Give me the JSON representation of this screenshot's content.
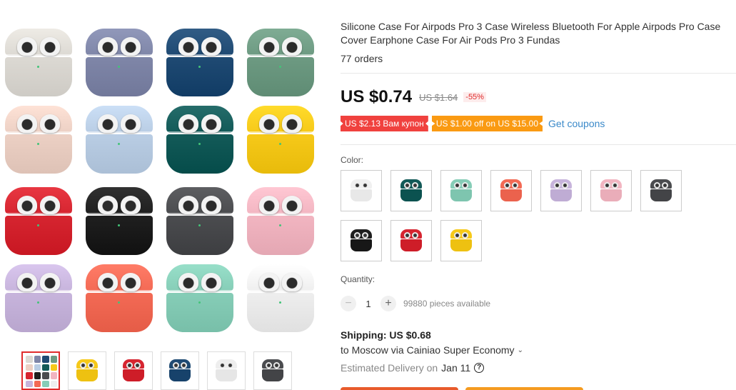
{
  "product": {
    "title": "Silicone Case For Airpods Pro 3 Case Wireless Bluetooth For Apple Airpods Pro Case Cover Earphone Case For Air Pods Pro 3 Fundas",
    "orders": "77 orders"
  },
  "price": {
    "current": "US $0.74",
    "original": "US $1.64",
    "discount": "-55%"
  },
  "coupons": {
    "store_coupon": "US $2.13 Вам купон",
    "promo_coupon": "US $1.00 off on US $15.00",
    "get_coupons": "Get coupons"
  },
  "color": {
    "label": "Color:",
    "options": [
      "white",
      "dark green",
      "mint",
      "coral",
      "lavender",
      "pink",
      "dark gray",
      "black",
      "red",
      "yellow"
    ]
  },
  "gallery": {
    "case_colors": [
      "#dcd9d3",
      "#7f86a8",
      "#1f4a73",
      "#6d9a82",
      "#ecd0c4",
      "#b9cde4",
      "#135a58",
      "#f6c919",
      "#d62530",
      "#1f1f1f",
      "#4b4c4f",
      "#f2b5c1",
      "#c7b4dc",
      "#f36a55",
      "#86cdb7",
      "#eeeeee"
    ],
    "thumb_colors": [
      "grid",
      "#f6c919",
      "#d62530",
      "#1f4a73",
      "#eeeeee",
      "#4b4c4f"
    ]
  },
  "swatch_colors": [
    "#f0f0f0",
    "#135a58",
    "#86cdb7",
    "#f36a55",
    "#c7b4dc",
    "#f2b5c1",
    "#4b4c4f",
    "#1f1f1f",
    "#d62530",
    "#f6c919"
  ],
  "quantity": {
    "label": "Quantity:",
    "value": "1",
    "available": "99880 pieces available"
  },
  "shipping": {
    "label": "Shipping: US $0.68",
    "destination": "to Moscow via Cainiao Super Economy",
    "delivery_prefix": "Estimated Delivery on",
    "delivery_date": "Jan 11"
  },
  "colors": {
    "accent_red": "#e02b2b",
    "coupon_red": "#f0413e",
    "coupon_orange": "#fa9a12",
    "link_blue": "#3a89c9"
  }
}
